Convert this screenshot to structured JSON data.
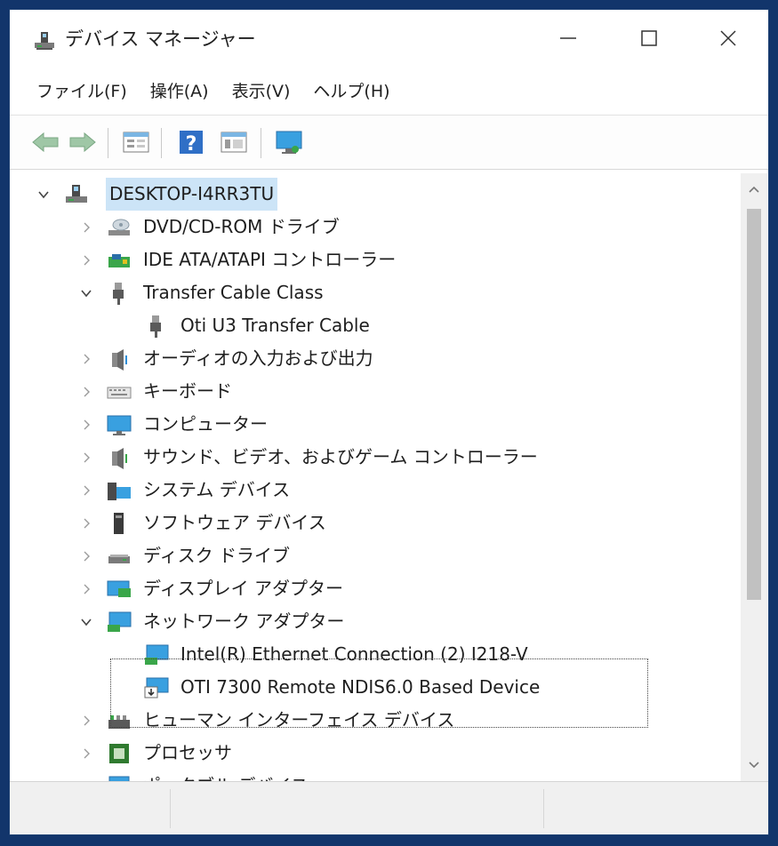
{
  "window": {
    "title": "デバイス マネージャー",
    "controls": {
      "minimize": "minimize",
      "maximize": "maximize",
      "close": "close"
    }
  },
  "menu": [
    {
      "label": "ファイル(F)"
    },
    {
      "label": "操作(A)"
    },
    {
      "label": "表示(V)"
    },
    {
      "label": "ヘルプ(H)"
    }
  ],
  "toolbar": [
    "back-arrow-icon",
    "forward-arrow-icon",
    "properties-icon",
    "help-icon",
    "update-driver-icon",
    "monitor-icon"
  ],
  "tree": {
    "root": {
      "label": "DESKTOP-I4RR3TU",
      "expanded": true
    },
    "items": [
      {
        "label": "DVD/CD-ROM ドライブ",
        "icon": "dvd-drive-icon",
        "expanded": false,
        "level": 1
      },
      {
        "label": "IDE ATA/ATAPI コントローラー",
        "icon": "ide-controller-icon",
        "expanded": false,
        "level": 1
      },
      {
        "label": "Transfer Cable Class",
        "icon": "usb-plug-icon",
        "expanded": true,
        "level": 1
      },
      {
        "label": "Oti U3 Transfer Cable",
        "icon": "usb-plug-icon",
        "level": 2
      },
      {
        "label": "オーディオの入力および出力",
        "icon": "speaker-icon",
        "expanded": false,
        "level": 1
      },
      {
        "label": "キーボード",
        "icon": "keyboard-icon",
        "expanded": false,
        "level": 1
      },
      {
        "label": "コンピューター",
        "icon": "computer-icon",
        "expanded": false,
        "level": 1
      },
      {
        "label": "サウンド、ビデオ、およびゲーム コントローラー",
        "icon": "speaker-icon",
        "expanded": false,
        "level": 1
      },
      {
        "label": "システム デバイス",
        "icon": "system-folder-icon",
        "expanded": false,
        "level": 1
      },
      {
        "label": "ソフトウェア デバイス",
        "icon": "software-device-icon",
        "expanded": false,
        "level": 1
      },
      {
        "label": "ディスク ドライブ",
        "icon": "disk-drive-icon",
        "expanded": false,
        "level": 1
      },
      {
        "label": "ディスプレイ アダプター",
        "icon": "display-adapter-icon",
        "expanded": false,
        "level": 1
      },
      {
        "label": "ネットワーク アダプター",
        "icon": "network-adapter-icon",
        "expanded": true,
        "level": 1
      },
      {
        "label": "Intel(R) Ethernet Connection (2) I218-V",
        "icon": "network-adapter-icon",
        "level": 2
      },
      {
        "label": "OTI 7300 Remote NDIS6.0 Based Device",
        "icon": "network-warning-icon",
        "level": 2
      },
      {
        "label": "ヒューマン インターフェイス デバイス",
        "icon": "hid-icon",
        "expanded": false,
        "level": 1
      },
      {
        "label": "プロセッサ",
        "icon": "processor-icon",
        "expanded": false,
        "level": 1
      },
      {
        "label": "ポータブル デバイス",
        "icon": "portable-device-icon",
        "expanded": false,
        "level": 1
      }
    ]
  },
  "colors": {
    "desktop": "#12356b",
    "selection": "#cce4f7",
    "icon_blue": "#2f8fd8",
    "icon_green": "#3aa64a"
  }
}
